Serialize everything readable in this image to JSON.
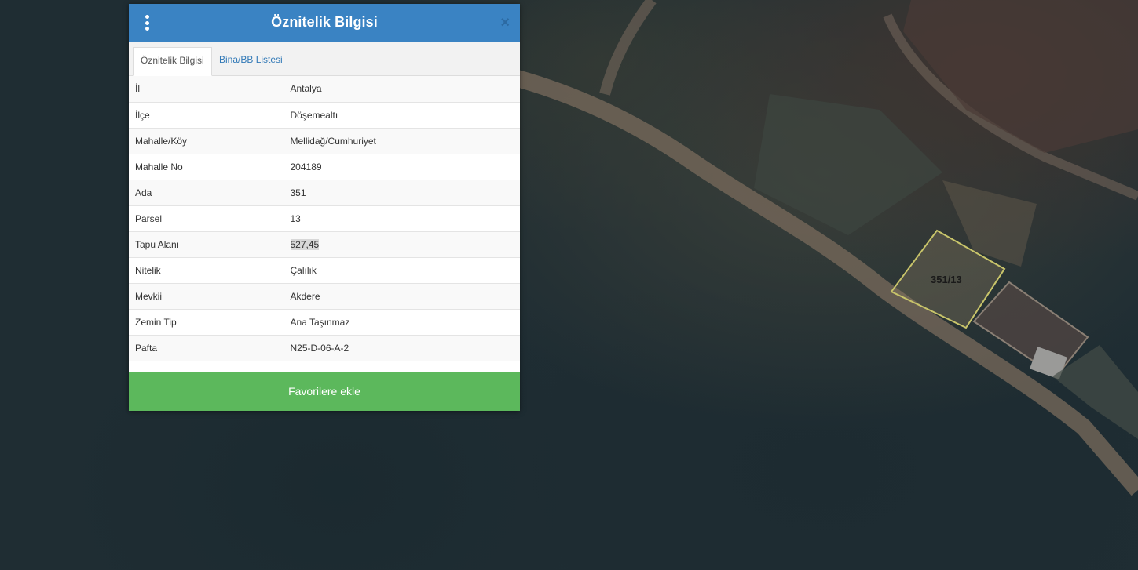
{
  "panel": {
    "title": "Öznitelik Bilgisi",
    "close_label": "×",
    "tabs": [
      {
        "label": "Öznitelik Bilgisi",
        "active": true
      },
      {
        "label": "Bina/BB Listesi",
        "active": false
      }
    ],
    "rows": [
      {
        "key": "İl",
        "value": "Antalya"
      },
      {
        "key": "İlçe",
        "value": "Döşemealtı"
      },
      {
        "key": "Mahalle/Köy",
        "value": "Mellidağ/Cumhuriyet"
      },
      {
        "key": "Mahalle No",
        "value": "204189"
      },
      {
        "key": "Ada",
        "value": "351"
      },
      {
        "key": "Parsel",
        "value": "13"
      },
      {
        "key": "Tapu Alanı",
        "value": "527,45"
      },
      {
        "key": "Nitelik",
        "value": "Çalılık"
      },
      {
        "key": "Mevkii",
        "value": "Akdere"
      },
      {
        "key": "Zemin Tip",
        "value": "Ana Taşınmaz"
      },
      {
        "key": "Pafta",
        "value": "N25-D-06-A-2"
      }
    ],
    "favorite_button_label": "Favorilere ekle"
  },
  "map": {
    "parcel_label": "351/13",
    "parcel_outline_color": "#c8c46a",
    "header_color": "#3a83c3",
    "button_color": "#5cb85c"
  },
  "icons": {
    "menu": "vertical-dots-icon",
    "close": "close-icon"
  }
}
